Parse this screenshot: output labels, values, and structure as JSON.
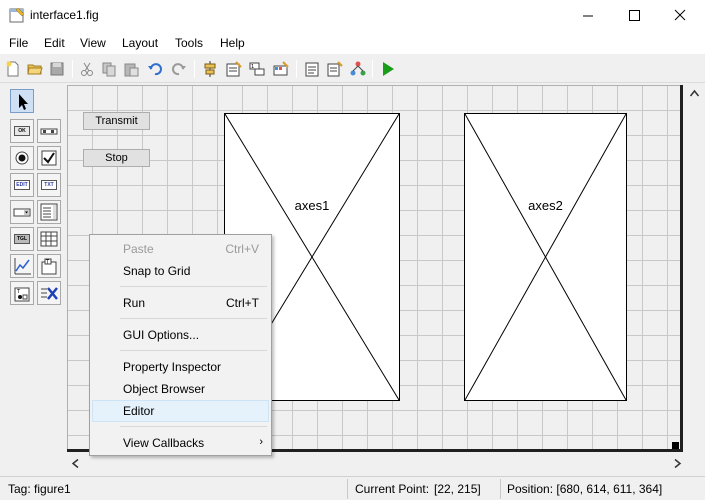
{
  "window": {
    "title": "interface1.fig"
  },
  "menu": [
    "File",
    "Edit",
    "View",
    "Layout",
    "Tools",
    "Help"
  ],
  "toolbar": {
    "icons": [
      "new-file-icon",
      "open-folder-icon",
      "save-icon",
      "cut-icon",
      "copy-icon",
      "paste-icon",
      "undo-icon",
      "redo-icon",
      "align-objects-icon",
      "menu-editor-icon",
      "tab-order-icon",
      "toolbar-editor-icon",
      "editor-icon",
      "property-inspector-icon",
      "object-browser-icon",
      "run-icon"
    ]
  },
  "palette": {
    "items": [
      {
        "name": "select-tool-icon",
        "tag": ""
      },
      {
        "name": "push-button-tool-icon",
        "tag": "OK"
      },
      {
        "name": "slider-tool-icon",
        "tag": ""
      },
      {
        "name": "radio-button-tool-icon",
        "tag": ""
      },
      {
        "name": "check-box-tool-icon",
        "tag": ""
      },
      {
        "name": "edit-text-tool-icon",
        "tag": "EDIT"
      },
      {
        "name": "static-text-tool-icon",
        "tag": "TXT"
      },
      {
        "name": "pop-up-menu-tool-icon",
        "tag": ""
      },
      {
        "name": "list-box-tool-icon",
        "tag": ""
      },
      {
        "name": "toggle-button-tool-icon",
        "tag": "TGL"
      },
      {
        "name": "table-tool-icon",
        "tag": ""
      },
      {
        "name": "axes-tool-icon",
        "tag": ""
      },
      {
        "name": "panel-tool-icon",
        "tag": ""
      },
      {
        "name": "button-group-tool-icon",
        "tag": ""
      },
      {
        "name": "activex-control-tool-icon",
        "tag": ""
      }
    ]
  },
  "canvas": {
    "buttons": {
      "transmit": "Transmit",
      "stop": "Stop"
    },
    "axes": {
      "axes1": "axes1",
      "axes2": "axes2"
    }
  },
  "context_menu": {
    "items": [
      {
        "label": "Paste",
        "shortcut": "Ctrl+V",
        "enabled": false
      },
      {
        "label": "Snap to Grid",
        "shortcut": "",
        "enabled": true
      },
      {
        "label": "Run",
        "shortcut": "Ctrl+T",
        "enabled": true
      },
      {
        "label": "GUI Options...",
        "shortcut": "",
        "enabled": true
      },
      {
        "label": "Property Inspector",
        "shortcut": "",
        "enabled": true
      },
      {
        "label": "Object Browser",
        "shortcut": "",
        "enabled": true
      },
      {
        "label": "Editor",
        "shortcut": "",
        "enabled": true,
        "highlighted": true
      },
      {
        "label": "View Callbacks",
        "shortcut": "",
        "enabled": true,
        "submenu": true
      }
    ]
  },
  "status": {
    "tag": "Tag: figure1",
    "current_point_label": "Current Point:",
    "current_point": "[22, 215]",
    "position": "Position: [680, 614, 611, 364]"
  },
  "colors": {
    "run_green": "#1a9e1a",
    "highlight": "#e5f1fb",
    "grid_line": "#c8c8c8"
  }
}
